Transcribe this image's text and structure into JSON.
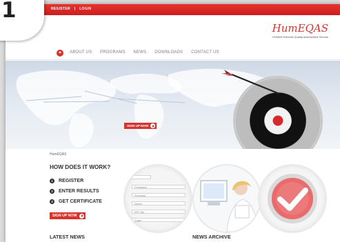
{
  "badge": {
    "number": "1"
  },
  "topbar": {
    "register": "REGISTER",
    "separator": "|",
    "login": "LOGIN"
  },
  "logo": {
    "name": "HumEQAS",
    "tagline": "HUMAN External Quality Assessment Service"
  },
  "nav": {
    "items": [
      "ABOUT US",
      "PROGRAMS",
      "NEWS",
      "DOWNLOADS",
      "CONTACT US"
    ]
  },
  "hero": {
    "signup": "SIGN UP NOW"
  },
  "content": {
    "breadcrumb": "HumEQAS",
    "heading": "HOW DOES IT WORK?",
    "steps": [
      {
        "n": "1",
        "label": "REGISTER"
      },
      {
        "n": "2",
        "label": "ENTER RESULTS"
      },
      {
        "n": "3",
        "label": "GET CERTIFICATE"
      }
    ],
    "signup": "SIGN UP NOW",
    "form_labels": [
      "Firstname",
      "Surname",
      "Street",
      "ZIP City",
      "Login"
    ],
    "latest_news": "LATEST NEWS",
    "news_archive": "NEWS ARCHIVE"
  },
  "colors": {
    "accent": "#d6332d"
  }
}
